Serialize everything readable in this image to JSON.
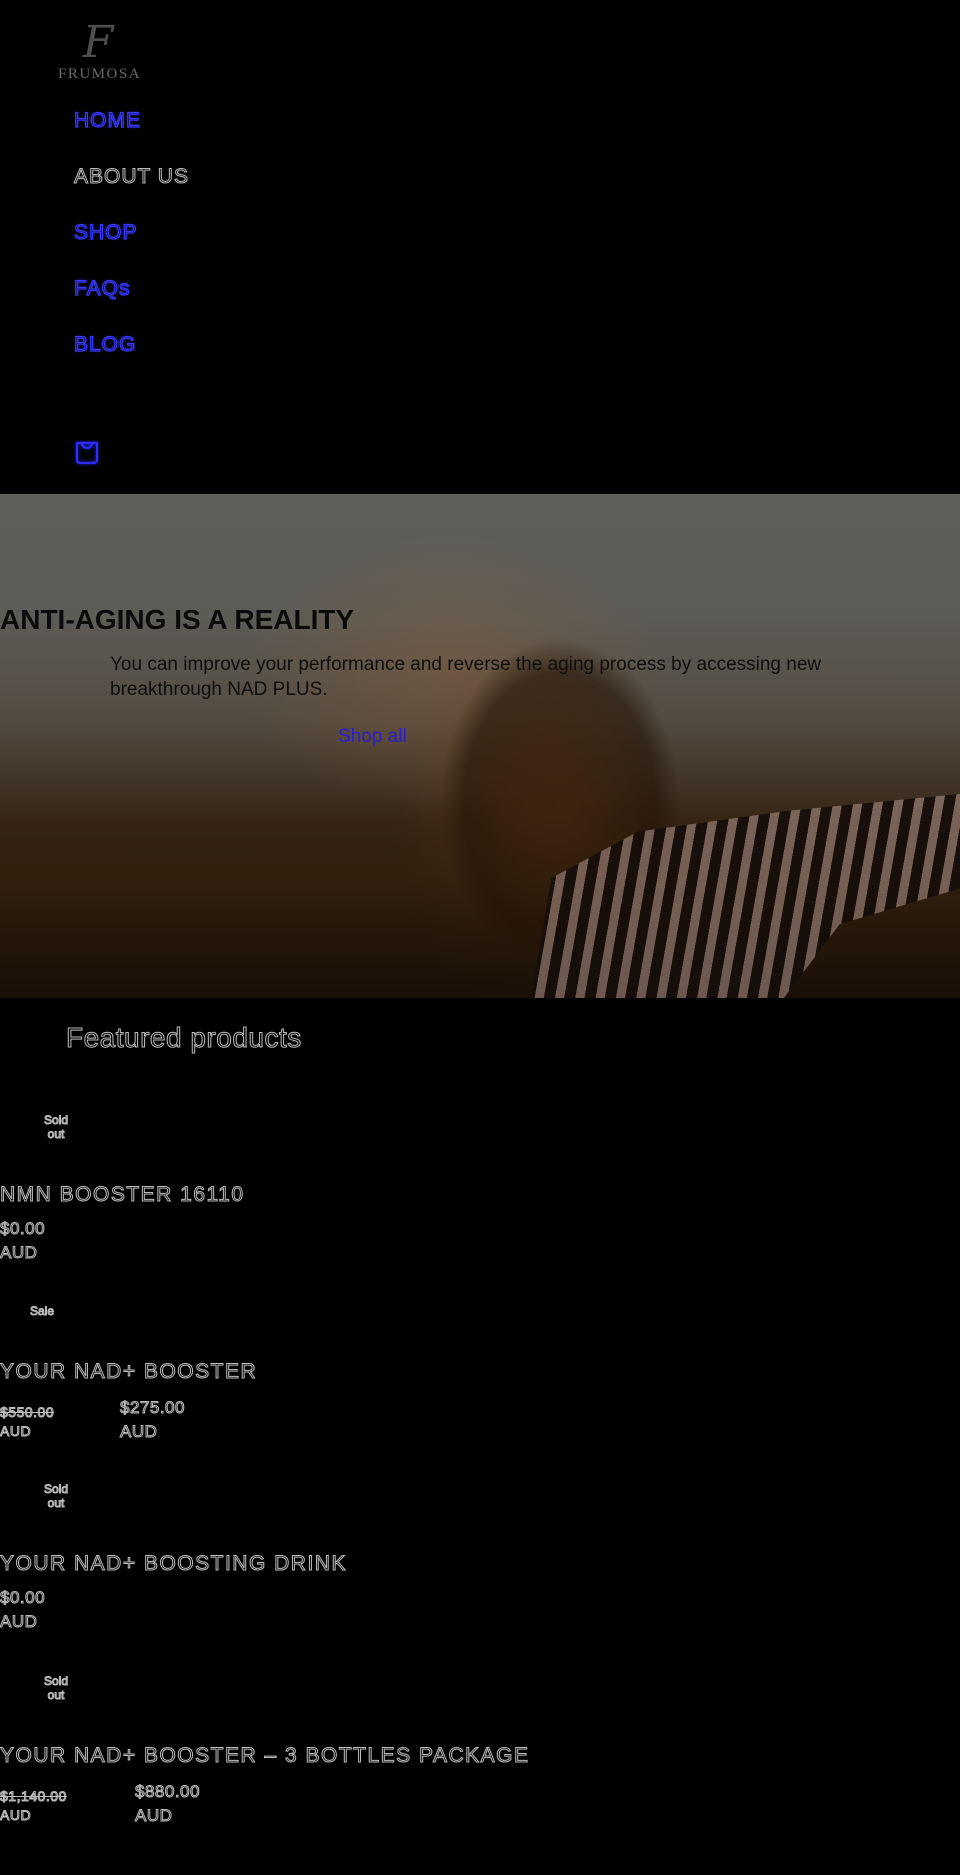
{
  "brand": {
    "mark": "F",
    "name": "FRUMOSA"
  },
  "nav": {
    "items": [
      {
        "label": "HOME",
        "state": "link"
      },
      {
        "label": "ABOUT US",
        "state": "current"
      },
      {
        "label": "SHOP",
        "state": "link"
      },
      {
        "label": "FAQs",
        "state": "link"
      },
      {
        "label": "BLOG",
        "state": "link"
      }
    ],
    "cart_icon": "shopping-bag-icon"
  },
  "hero": {
    "title": "ANTI-AGING IS A REALITY",
    "text": "You can improve your performance and reverse the aging process by accessing new breakthrough NAD PLUS.",
    "cta_label": "Shop all"
  },
  "featured": {
    "title": "Featured products",
    "products": [
      {
        "badge": "Sold out",
        "title": "NMN BOOSTER 16110",
        "price": "$0.00",
        "currency": "AUD"
      },
      {
        "badge": "Sale",
        "title": "YOUR NAD+ BOOSTER",
        "compare_price": "$550.00",
        "compare_currency": "AUD",
        "price": "$275.00",
        "currency": "AUD"
      },
      {
        "badge": "Sold out",
        "title": "YOUR NAD+ BOOSTING DRINK",
        "price": "$0.00",
        "currency": "AUD"
      },
      {
        "badge": "Sold out",
        "title": "YOUR NAD+ BOOSTER – 3 BOTTLES PACKAGE",
        "compare_price": "$1,140.00",
        "compare_currency": "AUD",
        "price": "$880.00",
        "currency": "AUD"
      }
    ]
  },
  "colors": {
    "link": "#3a3aff",
    "background": "#000000",
    "logo": "#5c5c5c"
  }
}
